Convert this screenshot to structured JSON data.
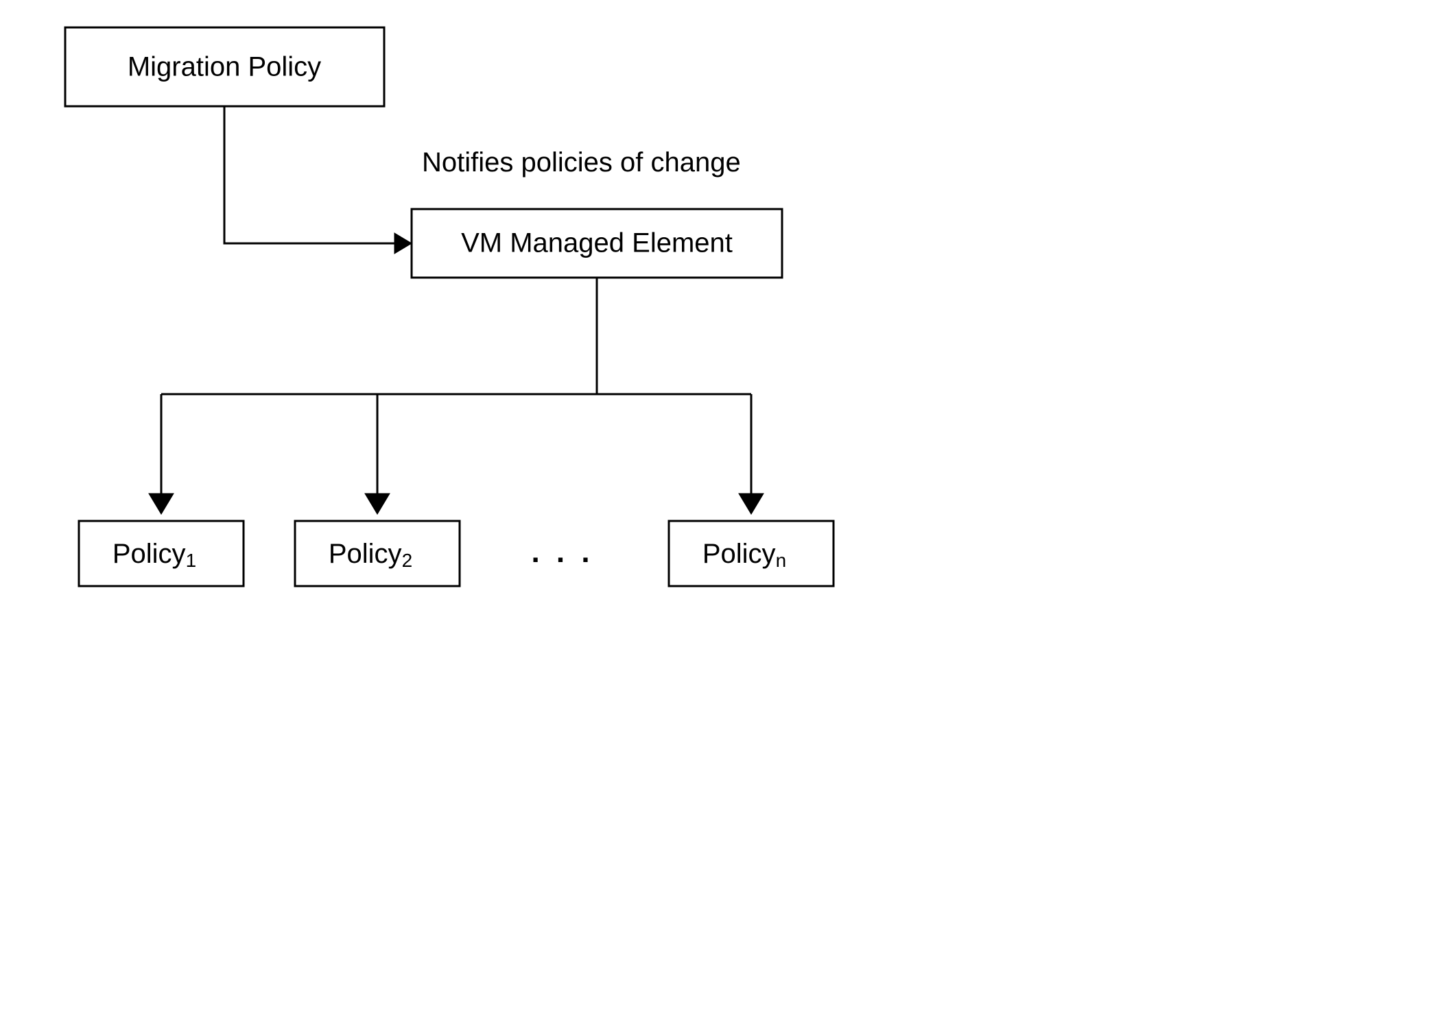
{
  "nodes": {
    "migration_policy": "Migration Policy",
    "vm_managed_element": "VM Managed Element",
    "policy_prefix": "Policy",
    "policy_subs": [
      "1",
      "2",
      "n"
    ]
  },
  "labels": {
    "notifies": "Notifies policies of change"
  },
  "ellipsis": ". . ."
}
